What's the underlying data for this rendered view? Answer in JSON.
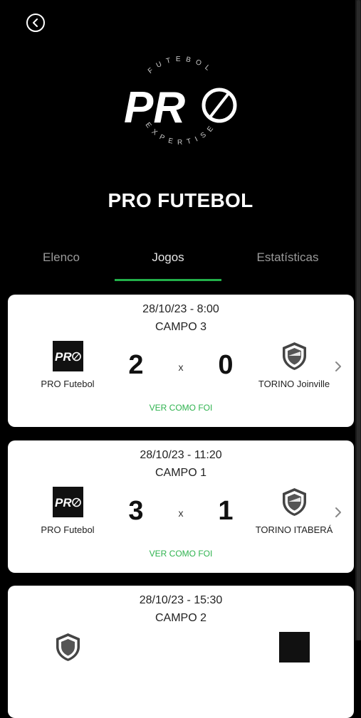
{
  "header": {
    "back_icon": "chevron-left-circle-icon",
    "logo": {
      "top_text": "FUTEBOL",
      "main_text": "PRO",
      "bottom_text": "EXPERTISE"
    },
    "team_name": "PRO FUTEBOL"
  },
  "tabs": [
    {
      "label": "Elenco",
      "active": false
    },
    {
      "label": "Jogos",
      "active": true
    },
    {
      "label": "Estatísticas",
      "active": false
    }
  ],
  "colors": {
    "accent": "#22b04a",
    "link": "#2fb34f",
    "background": "#000000",
    "card": "#ffffff"
  },
  "matches": [
    {
      "datetime": "28/10/23 - 8:00",
      "field": "CAMPO 3",
      "home_team": "PRO Futebol",
      "home_score": "2",
      "separator": "x",
      "away_score": "0",
      "away_team": "TORINO Joinville",
      "link": "VER COMO FOI"
    },
    {
      "datetime": "28/10/23 - 11:20",
      "field": "CAMPO 1",
      "home_team": "PRO Futebol",
      "home_score": "3",
      "separator": "x",
      "away_score": "1",
      "away_team": "TORINO ITABERÁ",
      "link": "VER COMO FOI"
    },
    {
      "datetime": "28/10/23 - 15:30",
      "field": "CAMPO 2"
    }
  ]
}
